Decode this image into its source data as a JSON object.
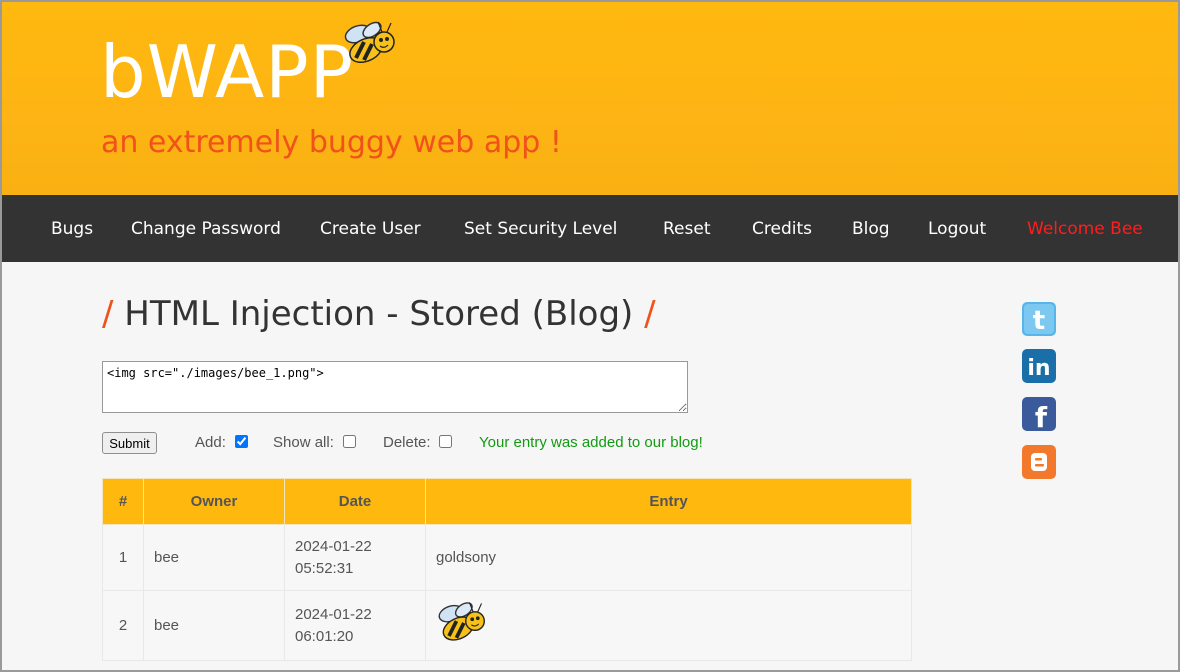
{
  "header": {
    "logo_text": "bWAPP",
    "tagline": "an extremely buggy web app !"
  },
  "nav": {
    "items": [
      {
        "label": "Bugs"
      },
      {
        "label": "Change Password"
      },
      {
        "label": "Create User"
      },
      {
        "label": "Set Security Level"
      },
      {
        "label": "Reset"
      },
      {
        "label": "Credits"
      },
      {
        "label": "Blog"
      },
      {
        "label": "Logout"
      },
      {
        "label": "Welcome Bee"
      }
    ]
  },
  "main": {
    "title_slash_left": "/",
    "title": "HTML Injection - Stored (Blog)",
    "title_slash_right": "/",
    "entry_value": "<img src=\"./images/bee_1.png\">",
    "submit_label": "Submit",
    "add_label": "Add:",
    "add_checked": true,
    "show_all_label": "Show all:",
    "show_all_checked": false,
    "delete_label": "Delete:",
    "delete_checked": false,
    "notice": "Your entry was added to our blog!"
  },
  "table": {
    "headers": [
      "#",
      "Owner",
      "Date",
      "Entry"
    ],
    "rows": [
      {
        "num": "1",
        "owner": "bee",
        "date_line1": "2024-01-22",
        "date_line2": "05:52:31",
        "entry": "goldsony"
      },
      {
        "num": "2",
        "owner": "bee",
        "date_line1": "2024-01-22",
        "date_line2": "06:01:20",
        "entry": "",
        "entry_image": "bee-image"
      }
    ]
  },
  "social": [
    "twitter-icon",
    "linkedin-icon",
    "facebook-icon",
    "blogger-icon"
  ],
  "colors": {
    "header_bg": "#ffb80e",
    "nav_bg": "#333333",
    "accent_orange": "#f1511b",
    "welcome_red": "#ff1d1d",
    "notice_green": "#129b12"
  }
}
